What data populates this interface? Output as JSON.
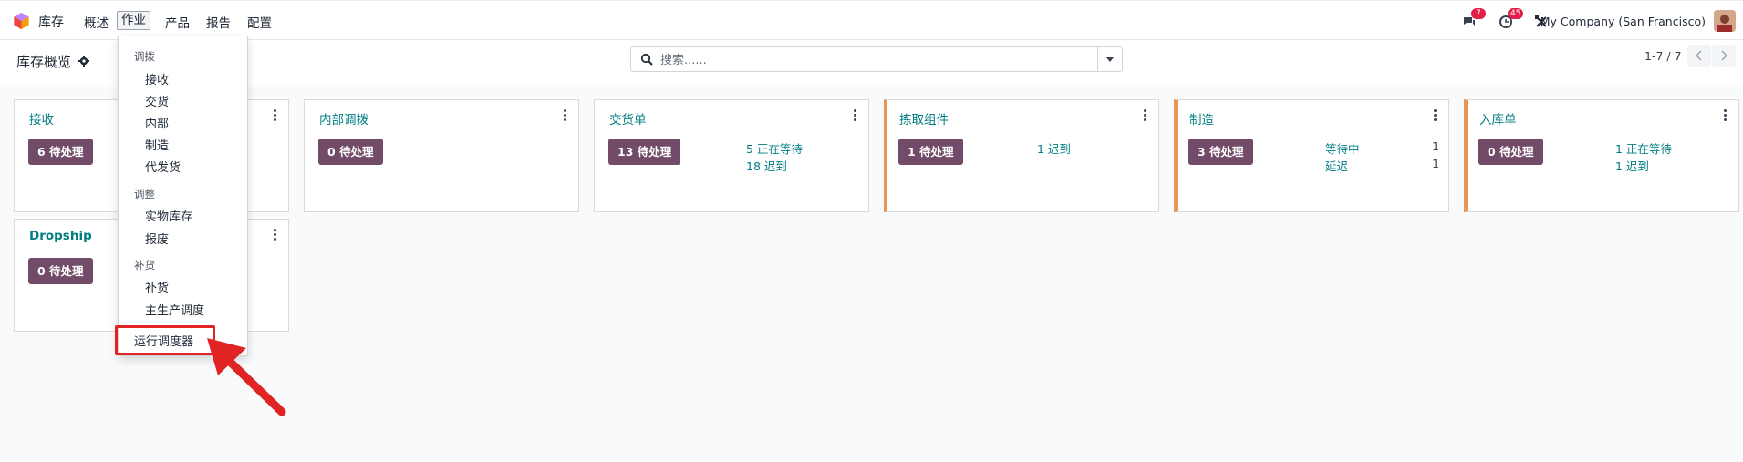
{
  "navbar": {
    "app_name": "库存",
    "menus": [
      "概述",
      "作业",
      "产品",
      "报告",
      "配置"
    ],
    "messages_count": "7",
    "activities_count": "45",
    "company": "My Company (San Francisco)"
  },
  "control_panel": {
    "title": "库存概览",
    "search_placeholder": "搜索......",
    "pager": "1-7 / 7"
  },
  "cards": [
    {
      "title": "接收",
      "todo": "6 待处理",
      "stats": []
    },
    {
      "title": "内部调拨",
      "todo": "0 待处理",
      "stats": []
    },
    {
      "title": "交货单",
      "todo": "13 待处理",
      "stats": [
        "5 正在等待",
        "18 迟到"
      ]
    },
    {
      "title": "拣取组件",
      "todo": "1 待处理",
      "stats": [
        "1 迟到"
      ]
    },
    {
      "title": "制造",
      "todo": "3 待处理",
      "stats": [
        "等待中",
        "延迟"
      ],
      "counts": [
        "1",
        "1"
      ]
    },
    {
      "title": "入库单",
      "todo": "0 待处理",
      "stats": [
        "1 正在等待",
        "1 迟到"
      ]
    },
    {
      "title": "Dropship",
      "todo": "0 待处理",
      "stats": []
    }
  ],
  "dropdown": {
    "sections": [
      {
        "header": "调拨",
        "items": [
          "接收",
          "交货",
          "内部",
          "制造",
          "代发货"
        ]
      },
      {
        "header": "调整",
        "items": [
          "实物库存",
          "报废"
        ]
      },
      {
        "header": "补货",
        "items": [
          "补货",
          "主生产调度"
        ]
      }
    ],
    "run_scheduler": "运行调度器"
  },
  "colors": {
    "brand": "#714b67",
    "link": "#017e84",
    "warning_border": "#e79654",
    "highlight": "#e02424"
  }
}
